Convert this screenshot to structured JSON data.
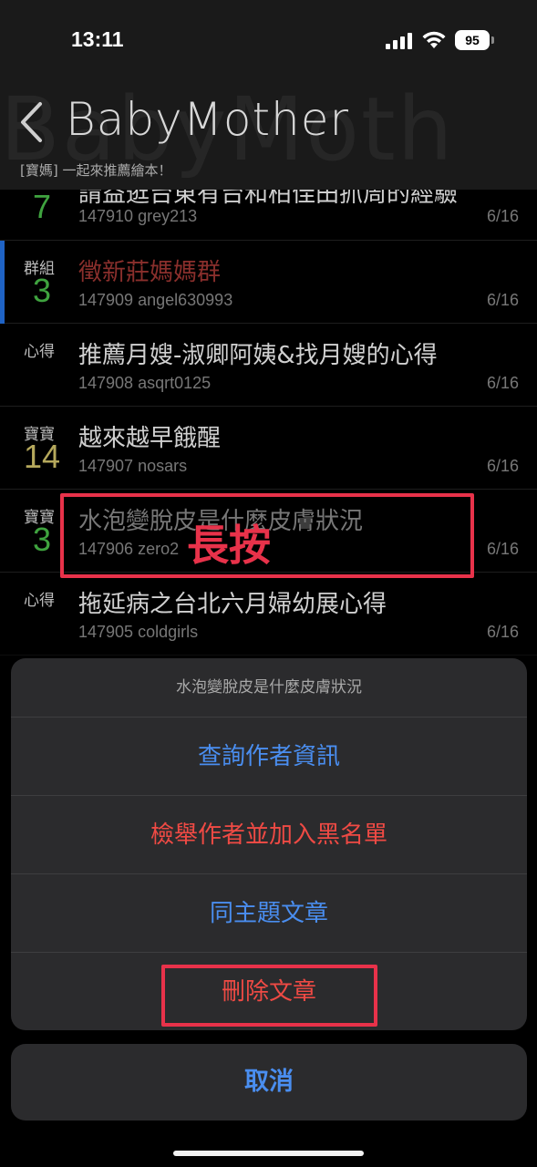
{
  "status_bar": {
    "time": "13:11",
    "battery": "95"
  },
  "header": {
    "title": "BabyMother",
    "watermark": "BabyMoth",
    "subtitle": "[寶媽] 一起來推薦繪本！"
  },
  "posts": [
    {
      "category": "",
      "count": "7",
      "count_color": "#3fa33f",
      "title": "請益逛台東有台和柏佳田抓周的經驗",
      "id": "147910",
      "author": "grey213",
      "date": "6/16",
      "title_color": "#d0d0d0"
    },
    {
      "category": "群組",
      "count": "3",
      "count_color": "#3fa33f",
      "title": "徵新莊媽媽群",
      "id": "147909",
      "author": "angel630993",
      "date": "6/16",
      "title_color": "#8a2f2c",
      "accent": true
    },
    {
      "category": "心得",
      "count": "",
      "count_color": "#3fa33f",
      "title": "推薦月嫂-淑卿阿姨&找月嫂的心得",
      "id": "147908",
      "author": "asqrt0125",
      "date": "6/16",
      "title_color": "#d0d0d0"
    },
    {
      "category": "寶寶",
      "count": "14",
      "count_color": "#b5a85c",
      "title": "越來越早餓醒",
      "id": "147907",
      "author": "nosars",
      "date": "6/16",
      "title_color": "#d0d0d0"
    },
    {
      "category": "寶寶",
      "count": "3",
      "count_color": "#3fa33f",
      "title": "水泡變脫皮是什麼皮膚狀況",
      "id": "147906",
      "author": "zero2",
      "date": "6/16",
      "title_color": "#777777"
    },
    {
      "category": "心得",
      "count": "",
      "count_color": "#3fa33f",
      "title": "拖延病之台北六月婦幼展心得",
      "id": "147905",
      "author": "coldgirls",
      "date": "6/16",
      "title_color": "#d0d0d0"
    }
  ],
  "annotation": {
    "long_press_label": "長按"
  },
  "action_sheet": {
    "title": "水泡變脫皮是什麼皮膚狀況",
    "actions": [
      {
        "label": "查詢作者資訊",
        "color": "#4a8ef0"
      },
      {
        "label": "檢舉作者並加入黑名單",
        "color": "#ef4a44"
      },
      {
        "label": "同主題文章",
        "color": "#4a8ef0"
      },
      {
        "label": "刪除文章",
        "color": "#ef4a44"
      }
    ],
    "cancel_label": "取消",
    "cancel_color": "#4a8ef0"
  }
}
